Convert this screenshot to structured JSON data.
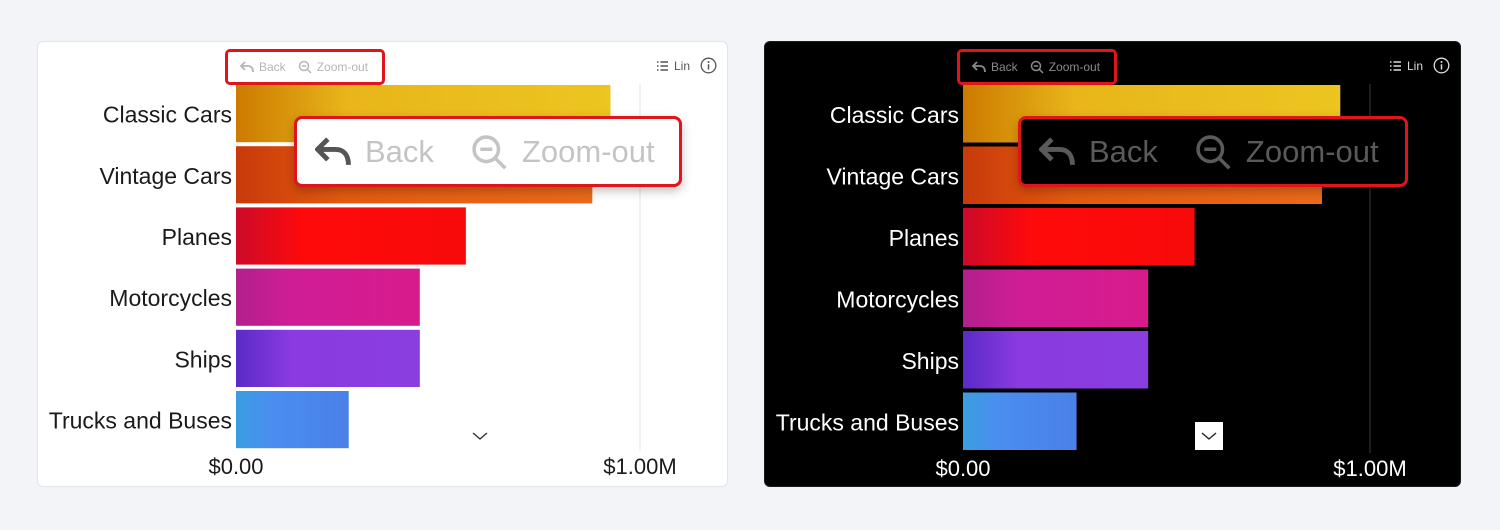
{
  "toolbar": {
    "back_label": "Back",
    "zoom_out_label": "Zoom-out",
    "scale_label": "Lin"
  },
  "callout": {
    "back_label": "Back",
    "zoom_out_label": "Zoom-out"
  },
  "themes": {
    "light": {
      "background": "#ffffff",
      "text": "#1a1a1a",
      "grid": "#e6e6e6"
    },
    "dark": {
      "background": "#000000",
      "text": "#ffffff",
      "grid": "#3a3a3a"
    }
  },
  "highlight_color": "#e0141b",
  "chart_data": {
    "type": "bar",
    "orientation": "horizontal",
    "categories": [
      "Classic Cars",
      "Vintage Cars",
      "Planes",
      "Motorcycles",
      "Ships",
      "Trucks and Buses"
    ],
    "values": [
      927000,
      882000,
      569000,
      455000,
      455000,
      279000
    ],
    "xlim": [
      0,
      1000000
    ],
    "x_tick_labels": [
      "$0.00",
      "$1.00M"
    ],
    "grid": true,
    "bar_gradients": [
      [
        "#cc7a00",
        "#e8b61a",
        "#ecc520"
      ],
      [
        "#c83a0a",
        "#e45a10",
        "#ea6a18"
      ],
      [
        "#cc0a2a",
        "#ff0a0a",
        "#f80a0a"
      ],
      [
        "#b2208c",
        "#cf1d96",
        "#d81b8c"
      ],
      [
        "#5a2bc7",
        "#8a3ae0",
        "#8a3ee0"
      ],
      [
        "#3a9ee0",
        "#4a8ef0",
        "#4a80e8"
      ]
    ]
  }
}
